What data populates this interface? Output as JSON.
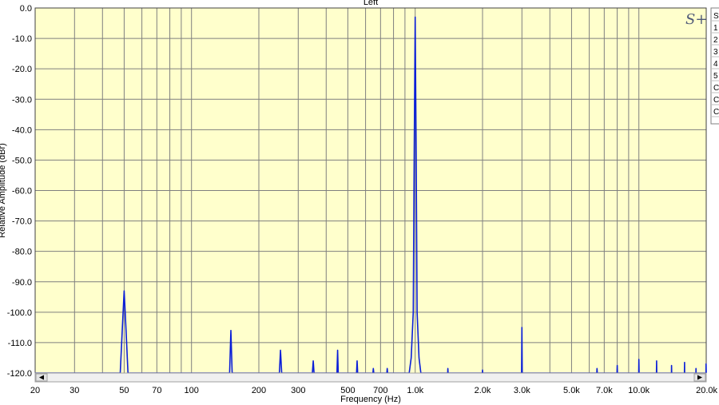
{
  "chart_data": {
    "type": "line",
    "title": "Left",
    "xlabel": "Frequency (Hz)",
    "ylabel": "Relative Amplitude (dBr)",
    "xscale": "log",
    "xlim": [
      20,
      20000
    ],
    "ylim": [
      -120,
      0
    ],
    "grid": true,
    "y_ticks": [
      "0.0",
      "-10.0",
      "-20.0",
      "-30.0",
      "-40.0",
      "-50.0",
      "-60.0",
      "-70.0",
      "-80.0",
      "-90.0",
      "-100.0",
      "-110.0",
      "-120.0"
    ],
    "x_tick_labels": [
      {
        "v": 20,
        "t": "20"
      },
      {
        "v": 30,
        "t": "30"
      },
      {
        "v": 50,
        "t": "50"
      },
      {
        "v": 70,
        "t": "70"
      },
      {
        "v": 100,
        "t": "100"
      },
      {
        "v": 200,
        "t": "200"
      },
      {
        "v": 300,
        "t": "300"
      },
      {
        "v": 500,
        "t": "500"
      },
      {
        "v": 700,
        "t": "700"
      },
      {
        "v": 1000,
        "t": "1.0k"
      },
      {
        "v": 2000,
        "t": "2.0k"
      },
      {
        "v": 3000,
        "t": "3.0k"
      },
      {
        "v": 5000,
        "t": "5.0k"
      },
      {
        "v": 7000,
        "t": "7.0k"
      },
      {
        "v": 10000,
        "t": "10.0k"
      },
      {
        "v": 20000,
        "t": "20.0k"
      }
    ],
    "series": [
      {
        "color": "#0a1ed8",
        "points": [
          [
            20,
            -120
          ],
          [
            48,
            -120
          ],
          [
            49,
            -106
          ],
          [
            50,
            -93
          ],
          [
            51,
            -106
          ],
          [
            52,
            -120
          ],
          [
            148,
            -120
          ],
          [
            150,
            -106
          ],
          [
            152,
            -120
          ],
          [
            247,
            -120
          ],
          [
            250,
            -112.5
          ],
          [
            253,
            -120
          ],
          [
            347,
            -120
          ],
          [
            350,
            -116
          ],
          [
            353,
            -120
          ],
          [
            447,
            -120
          ],
          [
            450,
            -112.5
          ],
          [
            453,
            -120
          ],
          [
            547,
            -120
          ],
          [
            550,
            -116
          ],
          [
            553,
            -120
          ],
          [
            647,
            -120
          ],
          [
            650,
            -118.5
          ],
          [
            653,
            -120
          ],
          [
            747,
            -120
          ],
          [
            750,
            -118.5
          ],
          [
            753,
            -120
          ],
          [
            940,
            -120
          ],
          [
            960,
            -115
          ],
          [
            980,
            -100
          ],
          [
            990,
            -47
          ],
          [
            1000,
            -3
          ],
          [
            1010,
            -47
          ],
          [
            1020,
            -100
          ],
          [
            1040,
            -115
          ],
          [
            1060,
            -120
          ],
          [
            1397,
            -120
          ],
          [
            1400,
            -118.5
          ],
          [
            1403,
            -120
          ],
          [
            1997,
            -120
          ],
          [
            2000,
            -119
          ],
          [
            2003,
            -120
          ],
          [
            2990,
            -120
          ],
          [
            3000,
            -105
          ],
          [
            3010,
            -120
          ],
          [
            6480,
            -120
          ],
          [
            6500,
            -118.5
          ],
          [
            6520,
            -120
          ],
          [
            7980,
            -120
          ],
          [
            8000,
            -117.5
          ],
          [
            8020,
            -120
          ],
          [
            9980,
            -120
          ],
          [
            10000,
            -115.5
          ],
          [
            10020,
            -120
          ],
          [
            11980,
            -120
          ],
          [
            12000,
            -116
          ],
          [
            12020,
            -120
          ],
          [
            13980,
            -120
          ],
          [
            14000,
            -117.5
          ],
          [
            14020,
            -120
          ],
          [
            15980,
            -120
          ],
          [
            16000,
            -116.5
          ],
          [
            16020,
            -120
          ],
          [
            17980,
            -120
          ],
          [
            18000,
            -118.5
          ],
          [
            18020,
            -120
          ],
          [
            19950,
            -120
          ],
          [
            19970,
            -117
          ],
          [
            20000,
            -120
          ]
        ]
      }
    ],
    "legend_rows": [
      "St",
      "1",
      "2",
      "3",
      "4",
      "5",
      "C",
      "C",
      "C"
    ]
  },
  "colors": {
    "plot_bg": "#ffffcc",
    "grid": "#7f7f7f",
    "trace": "#0a1ed8"
  },
  "logo_text": "S+"
}
